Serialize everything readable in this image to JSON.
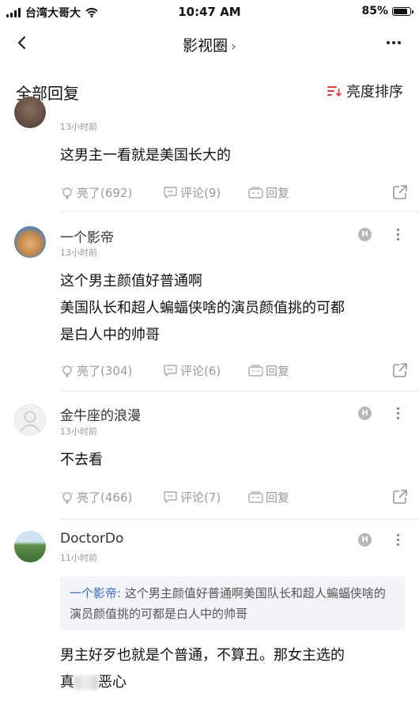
{
  "status_bar": {
    "carrier": "台湾大哥大",
    "time": "10:47 AM",
    "battery": "85%",
    "battery_level": 0.85
  },
  "nav": {
    "title": "影视圈",
    "chevron": "›"
  },
  "section": {
    "title": "全部回复",
    "sort_label": "亮度排序"
  },
  "comments": [
    {
      "timestamp": "13小时前",
      "lines": [
        "这男主一看就是美国长大的"
      ],
      "likes": "亮了(692)",
      "comments": "评论(9)",
      "reply": "回复"
    },
    {
      "username": "一个影帝",
      "timestamp": "13小时前",
      "lines": [
        "这个男主颜值好普通啊",
        "美国队长和超人蝙蝠侠啥的演员颜值挑的可都",
        "是白人中的帅哥"
      ],
      "likes": "亮了(304)",
      "comments": "评论(6)",
      "reply": "回复",
      "badge": "H"
    },
    {
      "username": "金牛座的浪漫",
      "timestamp": "13小时前",
      "lines": [
        "不去看"
      ],
      "likes": "亮了(466)",
      "comments": "评论(7)",
      "reply": "回复",
      "badge": "H"
    },
    {
      "username": "DoctorDo",
      "timestamp": "11小时前",
      "quote_author": "一个影帝:",
      "quote_text": " 这个男主颜值好普通啊美国队长和超人蝙蝠侠啥的演员颜值挑的可都是白人中的帅哥",
      "lines": [
        "男主好歹也就是个普通，不算丑。那女主选的"
      ],
      "line2_start": "真",
      "line2_end": "恶心",
      "badge": "H"
    }
  ],
  "colors": {
    "accent_red": "#e03a3a",
    "quote_link": "#3f6dc4",
    "muted": "#999999"
  }
}
